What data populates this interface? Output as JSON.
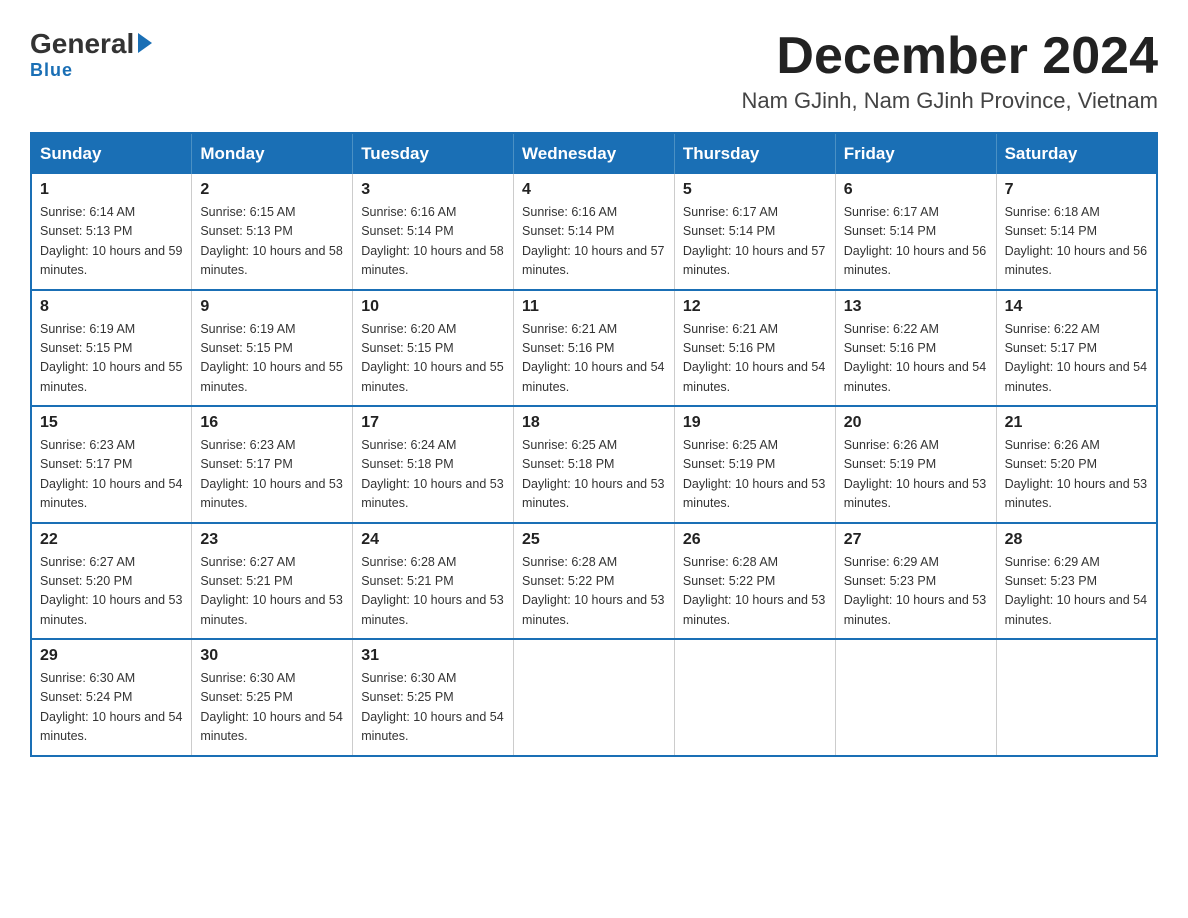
{
  "logo": {
    "general": "General",
    "blue": "Blue",
    "underline": "Blue"
  },
  "title": {
    "month_year": "December 2024",
    "location": "Nam GJinh, Nam GJinh Province, Vietnam"
  },
  "days_of_week": [
    "Sunday",
    "Monday",
    "Tuesday",
    "Wednesday",
    "Thursday",
    "Friday",
    "Saturday"
  ],
  "weeks": [
    [
      {
        "day": "1",
        "sunrise": "6:14 AM",
        "sunset": "5:13 PM",
        "daylight": "10 hours and 59 minutes."
      },
      {
        "day": "2",
        "sunrise": "6:15 AM",
        "sunset": "5:13 PM",
        "daylight": "10 hours and 58 minutes."
      },
      {
        "day": "3",
        "sunrise": "6:16 AM",
        "sunset": "5:14 PM",
        "daylight": "10 hours and 58 minutes."
      },
      {
        "day": "4",
        "sunrise": "6:16 AM",
        "sunset": "5:14 PM",
        "daylight": "10 hours and 57 minutes."
      },
      {
        "day": "5",
        "sunrise": "6:17 AM",
        "sunset": "5:14 PM",
        "daylight": "10 hours and 57 minutes."
      },
      {
        "day": "6",
        "sunrise": "6:17 AM",
        "sunset": "5:14 PM",
        "daylight": "10 hours and 56 minutes."
      },
      {
        "day": "7",
        "sunrise": "6:18 AM",
        "sunset": "5:14 PM",
        "daylight": "10 hours and 56 minutes."
      }
    ],
    [
      {
        "day": "8",
        "sunrise": "6:19 AM",
        "sunset": "5:15 PM",
        "daylight": "10 hours and 55 minutes."
      },
      {
        "day": "9",
        "sunrise": "6:19 AM",
        "sunset": "5:15 PM",
        "daylight": "10 hours and 55 minutes."
      },
      {
        "day": "10",
        "sunrise": "6:20 AM",
        "sunset": "5:15 PM",
        "daylight": "10 hours and 55 minutes."
      },
      {
        "day": "11",
        "sunrise": "6:21 AM",
        "sunset": "5:16 PM",
        "daylight": "10 hours and 54 minutes."
      },
      {
        "day": "12",
        "sunrise": "6:21 AM",
        "sunset": "5:16 PM",
        "daylight": "10 hours and 54 minutes."
      },
      {
        "day": "13",
        "sunrise": "6:22 AM",
        "sunset": "5:16 PM",
        "daylight": "10 hours and 54 minutes."
      },
      {
        "day": "14",
        "sunrise": "6:22 AM",
        "sunset": "5:17 PM",
        "daylight": "10 hours and 54 minutes."
      }
    ],
    [
      {
        "day": "15",
        "sunrise": "6:23 AM",
        "sunset": "5:17 PM",
        "daylight": "10 hours and 54 minutes."
      },
      {
        "day": "16",
        "sunrise": "6:23 AM",
        "sunset": "5:17 PM",
        "daylight": "10 hours and 53 minutes."
      },
      {
        "day": "17",
        "sunrise": "6:24 AM",
        "sunset": "5:18 PM",
        "daylight": "10 hours and 53 minutes."
      },
      {
        "day": "18",
        "sunrise": "6:25 AM",
        "sunset": "5:18 PM",
        "daylight": "10 hours and 53 minutes."
      },
      {
        "day": "19",
        "sunrise": "6:25 AM",
        "sunset": "5:19 PM",
        "daylight": "10 hours and 53 minutes."
      },
      {
        "day": "20",
        "sunrise": "6:26 AM",
        "sunset": "5:19 PM",
        "daylight": "10 hours and 53 minutes."
      },
      {
        "day": "21",
        "sunrise": "6:26 AM",
        "sunset": "5:20 PM",
        "daylight": "10 hours and 53 minutes."
      }
    ],
    [
      {
        "day": "22",
        "sunrise": "6:27 AM",
        "sunset": "5:20 PM",
        "daylight": "10 hours and 53 minutes."
      },
      {
        "day": "23",
        "sunrise": "6:27 AM",
        "sunset": "5:21 PM",
        "daylight": "10 hours and 53 minutes."
      },
      {
        "day": "24",
        "sunrise": "6:28 AM",
        "sunset": "5:21 PM",
        "daylight": "10 hours and 53 minutes."
      },
      {
        "day": "25",
        "sunrise": "6:28 AM",
        "sunset": "5:22 PM",
        "daylight": "10 hours and 53 minutes."
      },
      {
        "day": "26",
        "sunrise": "6:28 AM",
        "sunset": "5:22 PM",
        "daylight": "10 hours and 53 minutes."
      },
      {
        "day": "27",
        "sunrise": "6:29 AM",
        "sunset": "5:23 PM",
        "daylight": "10 hours and 53 minutes."
      },
      {
        "day": "28",
        "sunrise": "6:29 AM",
        "sunset": "5:23 PM",
        "daylight": "10 hours and 54 minutes."
      }
    ],
    [
      {
        "day": "29",
        "sunrise": "6:30 AM",
        "sunset": "5:24 PM",
        "daylight": "10 hours and 54 minutes."
      },
      {
        "day": "30",
        "sunrise": "6:30 AM",
        "sunset": "5:25 PM",
        "daylight": "10 hours and 54 minutes."
      },
      {
        "day": "31",
        "sunrise": "6:30 AM",
        "sunset": "5:25 PM",
        "daylight": "10 hours and 54 minutes."
      },
      null,
      null,
      null,
      null
    ]
  ]
}
